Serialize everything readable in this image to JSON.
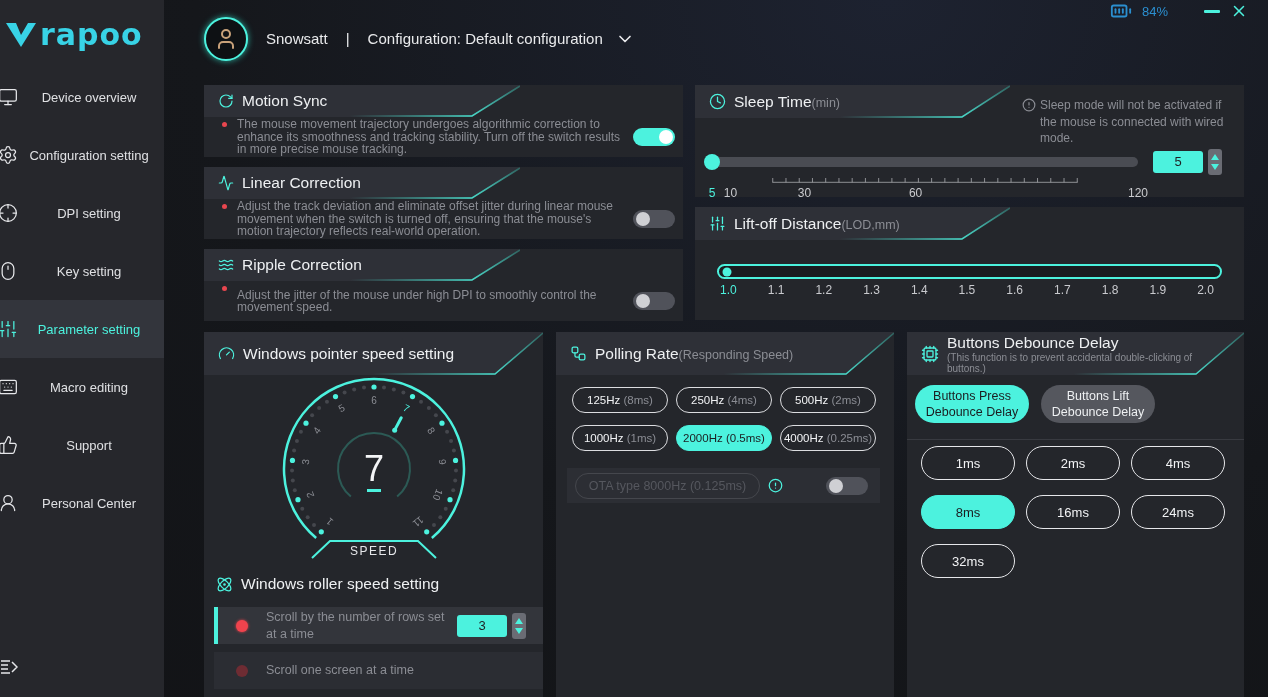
{
  "sidebar": {
    "logo": "rapoo",
    "items": [
      {
        "label": "Device overview",
        "selected": false
      },
      {
        "label": "Configuration setting",
        "selected": false
      },
      {
        "label": "DPI setting",
        "selected": false
      },
      {
        "label": "Key setting",
        "selected": false
      },
      {
        "label": "Parameter setting",
        "selected": true
      },
      {
        "label": "Macro editing",
        "selected": false
      },
      {
        "label": "Support",
        "selected": false
      },
      {
        "label": "Personal Center",
        "selected": false
      }
    ]
  },
  "header": {
    "user": "Snowsatt",
    "separator": "|",
    "configuration": "Configuration: Default configuration",
    "battery": "84%"
  },
  "switch_cards": [
    {
      "title": "Motion Sync",
      "description": "The mouse movement trajectory undergoes algorithmic correction to enhance its smoothness and tracking stability. Turn off the switch results in more precise mouse tracking.",
      "on": true
    },
    {
      "title": "Linear Correction",
      "description": "Adjust the track deviation and eliminate offset jitter during linear mouse movement when the switch is turned off, ensuring that the mouse's motion trajectory reflects real-world operation.",
      "on": false
    },
    {
      "title": "Ripple Correction",
      "description": "Adjust the jitter of the mouse under high DPI to smoothly control the movement speed.",
      "on": false
    }
  ],
  "sleep_time": {
    "title": "Sleep Time",
    "unit": "(min)",
    "note": "Sleep mode will not be activated if the mouse is connected with wired mode.",
    "level": 0,
    "value": "5",
    "ticks": [
      {
        "label": "5",
        "selected": true
      },
      {
        "label": "10",
        "selected": false
      },
      {
        "label": "30",
        "selected": false
      },
      {
        "label": "60",
        "selected": false
      },
      {
        "label": "120",
        "selected": false
      }
    ]
  },
  "lift_off_distance": {
    "title": "Lift-off Distance",
    "unit": "(LOD,mm)",
    "level": 0,
    "ticks": [
      {
        "label": "1.0",
        "selected": true
      },
      {
        "label": "1.1",
        "selected": false
      },
      {
        "label": "1.2",
        "selected": false
      },
      {
        "label": "1.3",
        "selected": false
      },
      {
        "label": "1.4",
        "selected": false
      },
      {
        "label": "1.5",
        "selected": false
      },
      {
        "label": "1.6",
        "selected": false
      },
      {
        "label": "1.7",
        "selected": false
      },
      {
        "label": "1.8",
        "selected": false
      },
      {
        "label": "1.9",
        "selected": false
      },
      {
        "label": "2.0",
        "selected": false
      }
    ]
  },
  "pointer_speed": {
    "title": "Windows pointer speed setting",
    "value": "7",
    "caption": "SPEED",
    "scale": [
      {
        "label": "1",
        "selected": false
      },
      {
        "label": "2",
        "selected": false
      },
      {
        "label": "3",
        "selected": false
      },
      {
        "label": "4",
        "selected": false
      },
      {
        "label": "5",
        "selected": false
      },
      {
        "label": "6",
        "selected": false
      },
      {
        "label": "7",
        "selected": true
      },
      {
        "label": "8",
        "selected": false
      },
      {
        "label": "9",
        "selected": false
      },
      {
        "label": "10",
        "selected": false
      },
      {
        "label": "11",
        "selected": false
      }
    ]
  },
  "roller_speed": {
    "title": "Windows roller speed setting",
    "options": [
      {
        "label": "Scroll by the number of rows set at a time",
        "selected": true,
        "value": "3"
      },
      {
        "label": "Scroll one screen at a time",
        "selected": false
      }
    ]
  },
  "polling_rate": {
    "title": "Polling Rate",
    "subtitle": "(Responding Speed)",
    "rates": [
      {
        "rate": "125Hz",
        "period": "(8ms)",
        "selected": false
      },
      {
        "rate": "250Hz",
        "period": "(4ms)",
        "selected": false
      },
      {
        "rate": "500Hz",
        "period": "(2ms)",
        "selected": false
      },
      {
        "rate": "1000Hz",
        "period": "(1ms)",
        "selected": false
      },
      {
        "rate": "2000Hz",
        "period": "(0.5ms)",
        "selected": true
      },
      {
        "rate": "4000Hz",
        "period": "(0.25ms)",
        "selected": false
      }
    ],
    "ota": {
      "label": "OTA type 8000Hz (0.125ms)",
      "disabled": true,
      "on": false
    }
  },
  "debounce": {
    "title": "Buttons Debounce Delay",
    "note": "(This function is to prevent accidental double-clicking of buttons.)",
    "tabs": [
      {
        "label": "Buttons Press Debounce Delay",
        "selected": true
      },
      {
        "label": "Buttons Lift Debounce Delay",
        "selected": false
      }
    ],
    "options": [
      {
        "label": "1ms",
        "selected": false
      },
      {
        "label": "2ms",
        "selected": false
      },
      {
        "label": "4ms",
        "selected": false
      },
      {
        "label": "8ms",
        "selected": true
      },
      {
        "label": "16ms",
        "selected": false
      },
      {
        "label": "24ms",
        "selected": false
      },
      {
        "label": "32ms",
        "selected": false
      }
    ]
  }
}
